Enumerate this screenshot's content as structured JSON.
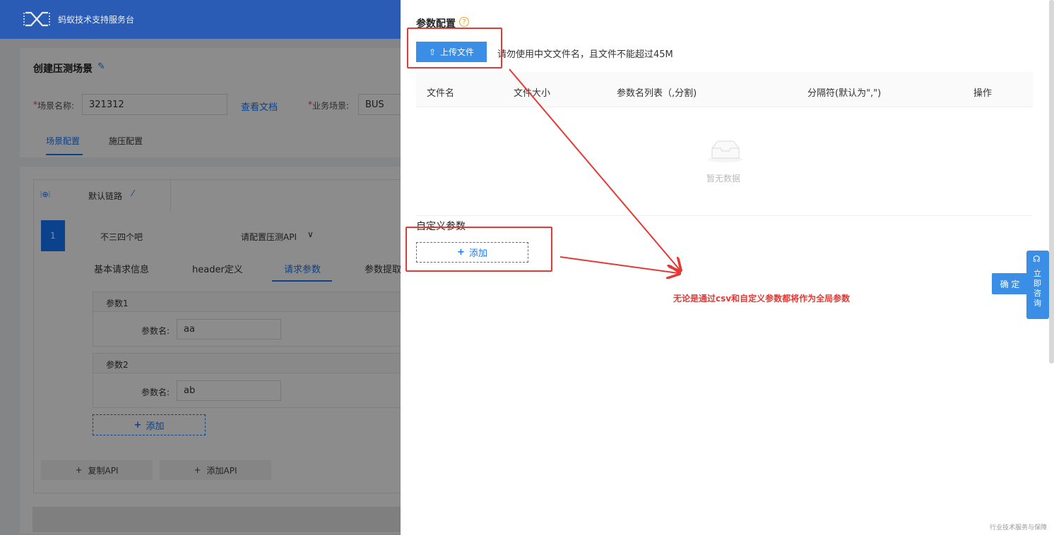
{
  "app": {
    "brand": "蚂蚁技术支持服务台"
  },
  "scene": {
    "title": "创建压测场景",
    "name_label": "场景名称:",
    "name_value": "321312",
    "doc_link": "查看文档",
    "biz_label": "业务场景:",
    "biz_value": "BUS",
    "tabs": [
      "场景配置",
      "施压配置"
    ]
  },
  "chain": {
    "label": "默认链路",
    "index": "1",
    "api_name": "不三四个吧",
    "api_select": "请配置压测API",
    "api_select_chevron": "∨"
  },
  "subtabs": [
    "基本请求信息",
    "header定义",
    "请求参数",
    "参数提取"
  ],
  "params": [
    {
      "title": "参数1",
      "label": "参数名:",
      "value": "aa"
    },
    {
      "title": "参数2",
      "label": "参数名:",
      "value": "ab"
    }
  ],
  "add_label": "添加",
  "copy_api": "复制API",
  "add_api": "添加API",
  "drawer": {
    "section_title": "参数配置",
    "upload_btn": "上传文件",
    "upload_hint": "请勿使用中文文件名，且文件不能超过45M",
    "columns": [
      "文件名",
      "文件大小",
      "参数名列表（,分割)",
      "分隔符(默认为\",\")",
      "操作"
    ],
    "empty_text": "暂无数据",
    "custom_title": "自定义参数",
    "add_btn": "添加",
    "annotation": "无论是通过csv和自定义参数都将作为全局参数",
    "confirm": "确 定",
    "consult": "立即咨询",
    "footer": "行业技术服务与保障"
  },
  "colors": {
    "primary": "#1677ff",
    "header": "#2a5bb5",
    "annotation": "#e53935"
  }
}
